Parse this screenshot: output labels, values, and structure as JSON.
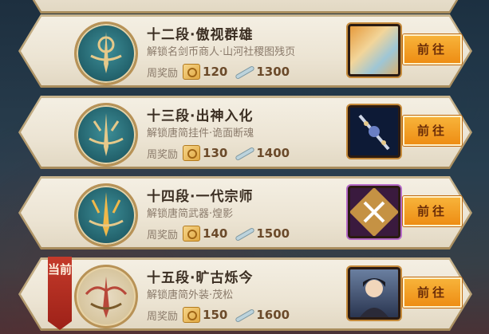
{
  "reward_label": "周奖励",
  "go_label": "前往",
  "current_label": "当前",
  "ranks": [
    {
      "title": "十二段·傲视群雄",
      "desc": "解锁名剑币商人·山河社稷图残页",
      "token": "120",
      "sword": "1300",
      "item_icon": "map-scroll-icon"
    },
    {
      "title": "十三段·出神入化",
      "desc": "解锁唐简挂件·诡面断魂",
      "token": "130",
      "sword": "1400",
      "item_icon": "ornament-pendant-icon"
    },
    {
      "title": "十四段·一代宗师",
      "desc": "解锁唐简武器·煌影",
      "token": "140",
      "sword": "1500",
      "item_icon": "crossed-blades-icon"
    },
    {
      "title": "十五段·旷古烁今",
      "desc": "解锁唐简外装·茂松",
      "token": "150",
      "sword": "1600",
      "item_icon": "character-portrait-icon"
    }
  ],
  "colors": {
    "accent": "#ee8d14",
    "ribbon": "#c43a2a"
  }
}
